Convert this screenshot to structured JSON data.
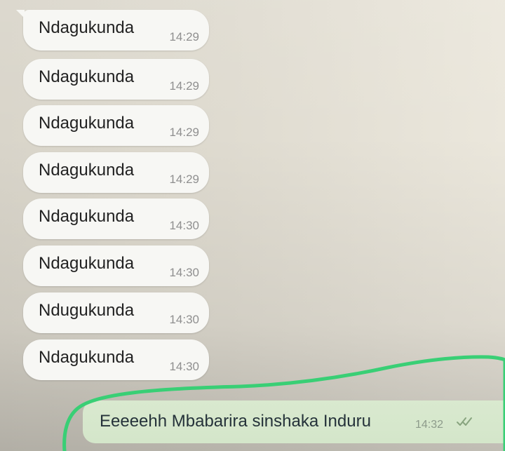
{
  "incoming_messages": [
    {
      "text": "Ndagukunda",
      "time": "14:29"
    },
    {
      "text": "Ndagukunda",
      "time": "14:29"
    },
    {
      "text": "Ndagukunda",
      "time": "14:29"
    },
    {
      "text": "Ndagukunda",
      "time": "14:29"
    },
    {
      "text": "Ndagukunda",
      "time": "14:30"
    },
    {
      "text": "Ndagukunda",
      "time": "14:30"
    },
    {
      "text": "Ndugukunda",
      "time": "14:30"
    },
    {
      "text": "Ndagukunda",
      "time": "14:30"
    }
  ],
  "outgoing_message": {
    "text": "Eeeeehh Mbabarira sinshaka Induru",
    "time": "14:32",
    "status_icon": "double-check-icon"
  },
  "colors": {
    "incoming_bubble": "#f7f7f4",
    "outgoing_bubble": "#d4e6ca",
    "highlight": "#39cf75"
  }
}
